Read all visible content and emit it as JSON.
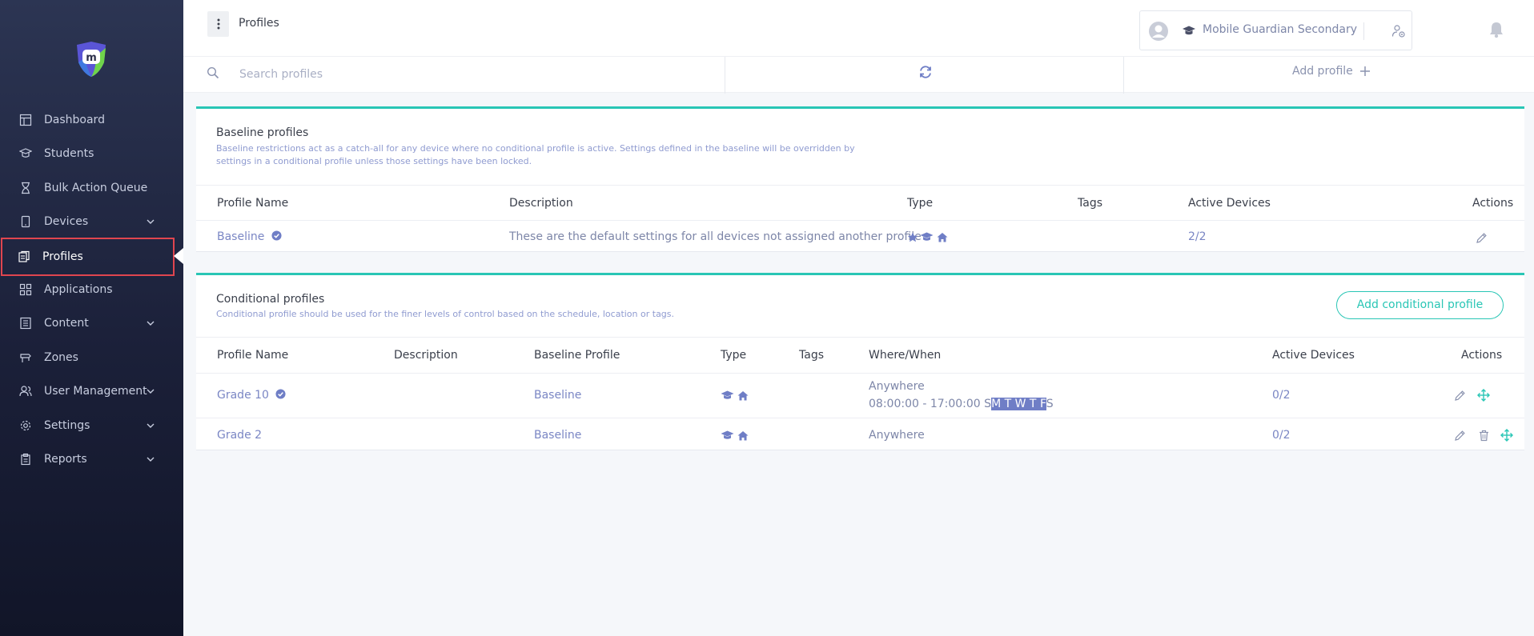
{
  "header": {
    "page_title": "Profiles",
    "org_name": "Mobile Guardian Secondary"
  },
  "nav": [
    {
      "label": "Dashboard",
      "icon": "dashboard-icon"
    },
    {
      "label": "Students",
      "icon": "students-icon"
    },
    {
      "label": "Bulk Action Queue",
      "icon": "hourglass-icon"
    },
    {
      "label": "Devices",
      "icon": "device-icon",
      "expandable": true
    },
    {
      "label": "Profiles",
      "icon": "profiles-icon",
      "active": true
    },
    {
      "label": "Applications",
      "icon": "grid-icon"
    },
    {
      "label": "Content",
      "icon": "content-icon",
      "expandable": true
    },
    {
      "label": "Zones",
      "icon": "zones-icon"
    },
    {
      "label": "User Management",
      "icon": "users-icon",
      "expandable": true
    },
    {
      "label": "Settings",
      "icon": "gear-icon",
      "expandable": true
    },
    {
      "label": "Reports",
      "icon": "reports-icon",
      "expandable": true
    }
  ],
  "search": {
    "placeholder": "Search profiles",
    "add_profile_label": "Add profile"
  },
  "baseline": {
    "title": "Baseline profiles",
    "description": "Baseline restrictions act as a catch-all for any device where no conditional profile is active. Settings defined in the baseline will be overridden by settings in a conditional profile unless those settings have been locked.",
    "columns": [
      "Profile Name",
      "Description",
      "Type",
      "Tags",
      "Active Devices",
      "Actions"
    ],
    "rows": [
      {
        "name": "Baseline",
        "description": "These are the default settings for all devices not assigned another profile",
        "tags": "",
        "active_devices": "2/2"
      }
    ]
  },
  "conditional": {
    "title": "Conditional profiles",
    "description": "Conditional profile should be used for the finer levels of control based on the schedule, location or tags.",
    "add_label": "Add conditional profile",
    "columns": [
      "Profile Name",
      "Description",
      "Baseline Profile",
      "Type",
      "Tags",
      "Where/When",
      "Active Devices",
      "Actions"
    ],
    "rows": [
      {
        "name": "Grade 10",
        "baseline": "Baseline",
        "where": "Anywhere",
        "time": "08:00:00 - 17:00:00",
        "days": [
          "S",
          "M",
          "T",
          "W",
          "T",
          "F",
          "S"
        ],
        "active_devices": "0/2"
      },
      {
        "name": "Grade 2",
        "baseline": "Baseline",
        "where": "Anywhere",
        "active_devices": "0/2"
      }
    ]
  },
  "colors": {
    "accent": "#29c6b5",
    "link": "#7a86c4",
    "active_border": "#e0454f"
  }
}
